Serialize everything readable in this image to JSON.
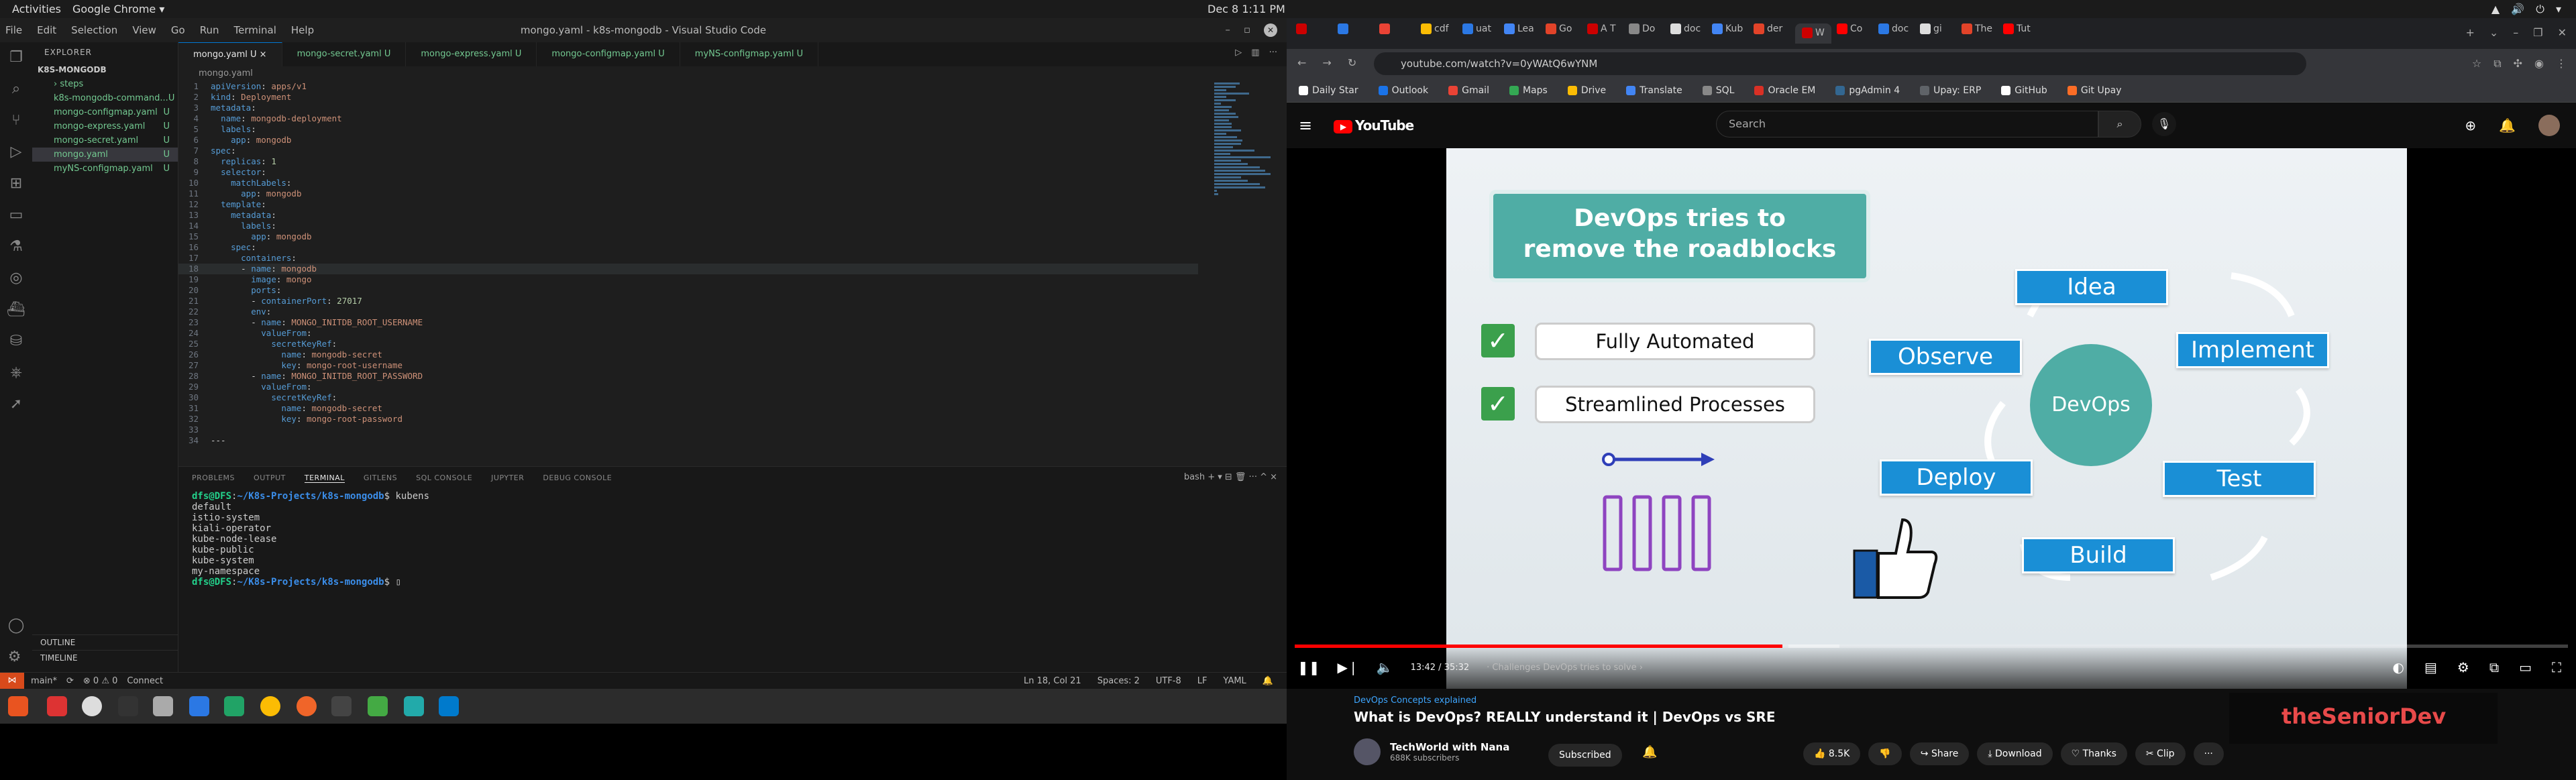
{
  "topbar": {
    "activities": "Activities",
    "app": "Google Chrome ▾",
    "clock": "Dec 8  1:11 PM",
    "tray": "▲ 🔊 ⏻ ▾"
  },
  "vscode": {
    "menu": [
      "File",
      "Edit",
      "Selection",
      "View",
      "Go",
      "Run",
      "Terminal",
      "Help"
    ],
    "title": "mongo.yaml - k8s-mongodb - Visual Studio Code",
    "explorer_header": "EXPLORER",
    "project": "K8S-MONGODB",
    "files": [
      {
        "name": "› steps",
        "badge": "",
        "cls": "g"
      },
      {
        "name": "k8s-mongodb-command...",
        "badge": "U",
        "cls": "g"
      },
      {
        "name": "mongo-configmap.yaml",
        "badge": "U",
        "cls": "g"
      },
      {
        "name": "mongo-express.yaml",
        "badge": "U",
        "cls": "g"
      },
      {
        "name": "mongo-secret.yaml",
        "badge": "U",
        "cls": "g"
      },
      {
        "name": "mongo.yaml",
        "badge": "U",
        "cls": "g sel"
      },
      {
        "name": "myNS-configmap.yaml",
        "badge": "U",
        "cls": "g"
      }
    ],
    "outline": "OUTLINE",
    "timeline": "TIMELINE",
    "tabs": [
      "mongo.yaml  U  ×",
      "mongo-secret.yaml  U",
      "mongo-express.yaml  U",
      "mongo-configmap.yaml  U",
      "myNS-configmap.yaml  U"
    ],
    "breadcrumb": "mongo.yaml",
    "code": [
      "apiVersion: apps/v1",
      "kind: Deployment",
      "metadata:",
      "  name: mongodb-deployment",
      "  labels:",
      "    app: mongodb",
      "spec:",
      "  replicas: 1",
      "  selector:",
      "    matchLabels:",
      "      app: mongodb",
      "  template:",
      "    metadata:",
      "      labels:",
      "        app: mongodb",
      "    spec:",
      "      containers:",
      "      - name: mongodb",
      "        image: mongo",
      "        ports:",
      "        - containerPort: 27017",
      "        env:",
      "        - name: MONGO_INITDB_ROOT_USERNAME",
      "          valueFrom:",
      "            secretKeyRef:",
      "              name: mongodb-secret",
      "              key: mongo-root-username",
      "        - name: MONGO_INITDB_ROOT_PASSWORD",
      "          valueFrom:",
      "            secretKeyRef:",
      "              name: mongodb-secret",
      "              key: mongo-root-password",
      "",
      "---"
    ],
    "current_line": 18,
    "panel_tabs": [
      "PROBLEMS",
      "OUTPUT",
      "TERMINAL",
      "GITLENS",
      "SQL CONSOLE",
      "JUPYTER",
      "DEBUG CONSOLE"
    ],
    "panel_active": 2,
    "terminal_shell": "bash  + ▾  ⊟  🗑  ···  ^  ×",
    "terminal": {
      "prompt_user": "dfs@DFS",
      "path": "~/K8s-Projects/k8s-mongodb",
      "command": "kubens",
      "output": [
        "default",
        "istio-system",
        "kiali-operator",
        "kube-node-lease",
        "kube-public",
        "kube-system",
        "my-namespace"
      ]
    },
    "status": {
      "branch": "main*",
      "sync": "⟳",
      "errors": "⊗ 0 ⚠ 0",
      "connect": "Connect",
      "position": "Ln 18, Col 21",
      "spaces": "Spaces: 2",
      "encoding": "UTF-8",
      "eol": "LF",
      "lang": "YAML"
    }
  },
  "chrome": {
    "tabs": [
      "",
      "",
      "",
      "cdf",
      "uat",
      "Lea",
      "Go",
      "A T",
      "Do",
      "doc",
      "Kub",
      "der",
      "W",
      "Co",
      "doc",
      "gi",
      "The",
      "Tut"
    ],
    "url": "youtube.com/watch?v=0yWAtQ6wYNM",
    "bookmarks": [
      "Daily Star",
      "Outlook",
      "Gmail",
      "Maps",
      "Drive",
      "Translate",
      "SQL",
      "Oracle EM",
      "pgAdmin 4",
      "Upay: ERP",
      "GitHub",
      "Git Upay"
    ],
    "bookmark_colors": [
      "#ffffff",
      "#1a73e8",
      "#ea4335",
      "#34a853",
      "#fbbc04",
      "#4285f4",
      "#888888",
      "#d93025",
      "#336791",
      "#5f6368",
      "#ffffff",
      "#fc6d26"
    ]
  },
  "youtube": {
    "search_placeholder": "Search",
    "slide": {
      "banner_line1": "DevOps tries to",
      "banner_line2": "remove the roadblocks",
      "item1": "Fully Automated",
      "item2": "Streamlined Processes",
      "cycle": [
        "Idea",
        "Implement",
        "Test",
        "Build",
        "Deploy",
        "Observe"
      ],
      "hub": "DevOps"
    },
    "progress": 0.383,
    "time": "13:42 / 35:32",
    "chapter": "· Challenges DevOps tries to solve ›",
    "tag": "DevOps Concepts explained",
    "title": "What is DevOps? REALLY understand it | DevOps vs SRE",
    "channel": "TechWorld with Nana",
    "subscribers": "688K subscribers",
    "subscribed": "Subscribed",
    "likes": "👍 8.5K",
    "dislike": "👎",
    "share": "↪ Share",
    "download": "⤓ Download",
    "thanks": "♡ Thanks",
    "clip": "✂ Clip",
    "more": "···",
    "ad": "theSeniorDev"
  }
}
